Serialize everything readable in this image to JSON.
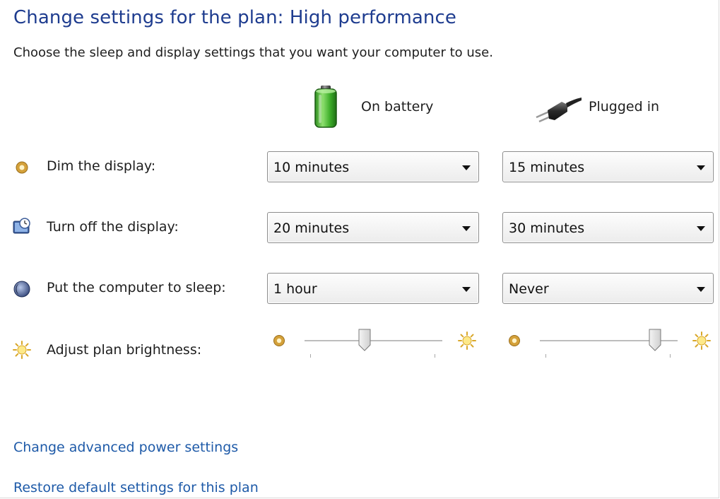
{
  "page": {
    "title": "Change settings for the plan: High performance",
    "subtitle": "Choose the sleep and display settings that you want your computer to use."
  },
  "columns": {
    "battery": {
      "label": "On battery",
      "icon": "battery-icon"
    },
    "plugged": {
      "label": "Plugged in",
      "icon": "power-plug-icon"
    }
  },
  "rows": [
    {
      "label": "Dim the display:",
      "icon": "dim-display-icon",
      "battery": "10 minutes",
      "plugged": "15 minutes"
    },
    {
      "label": "Turn off the display:",
      "icon": "monitor-clock-icon",
      "battery": "20 minutes",
      "plugged": "30 minutes"
    },
    {
      "label": "Put the computer to sleep:",
      "icon": "sleep-moon-icon",
      "battery": "1 hour",
      "plugged": "Never"
    }
  ],
  "brightness": {
    "label": "Adjust plan brightness:",
    "icon": "brightness-sun-icon",
    "battery_level": 0.43,
    "plugged_level": 0.87
  },
  "links": {
    "advanced": "Change advanced power settings",
    "restore": "Restore default settings for this plan"
  }
}
